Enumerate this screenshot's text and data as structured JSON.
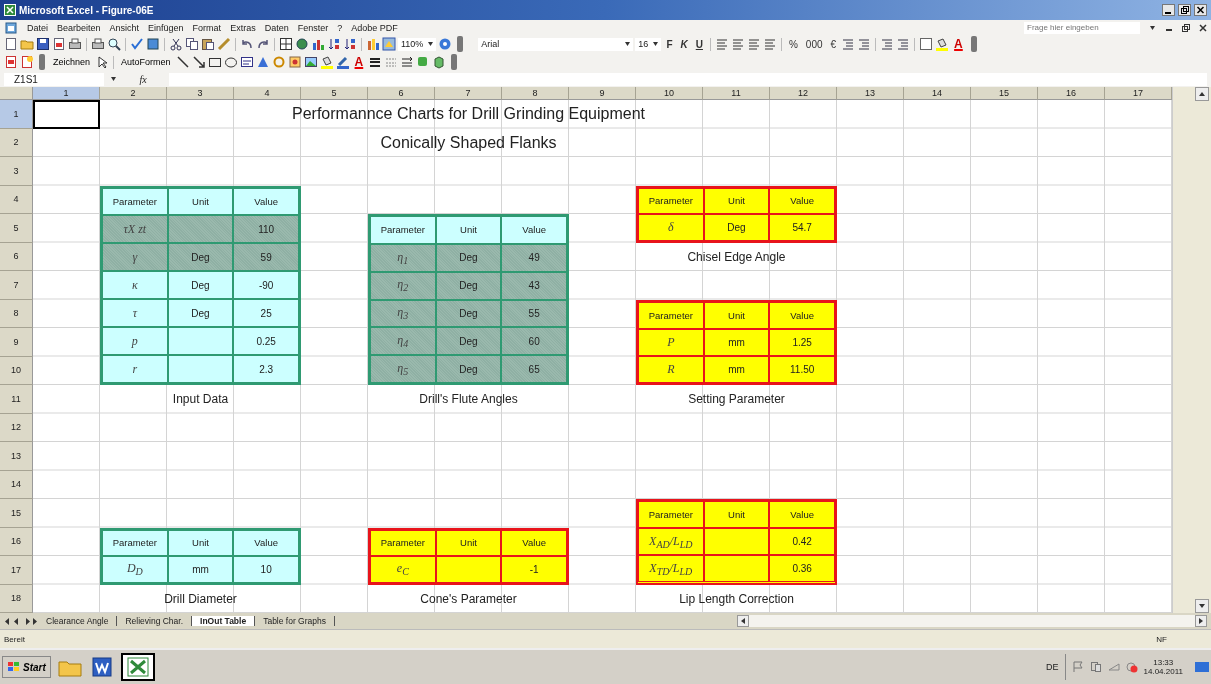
{
  "window": {
    "title": "Microsoft Excel - Figure-06E"
  },
  "menu": [
    "Datei",
    "Bearbeiten",
    "Ansicht",
    "Einfügen",
    "Format",
    "Extras",
    "Daten",
    "Fenster",
    "?",
    "Adobe PDF"
  ],
  "help_search": {
    "placeholder": "Frage hier eingeben"
  },
  "standard_toolbar": {
    "zoom": "110%"
  },
  "format_toolbar": {
    "font": "Arial",
    "size": "16",
    "style_buttons": [
      "F",
      "K",
      "U"
    ],
    "number_buttons": [
      "%",
      "000",
      "€"
    ],
    "font_color": "A"
  },
  "drawing_toolbar": {
    "menus": [
      "Zeichnen",
      "AutoFormen"
    ],
    "font_color": "A"
  },
  "formula_bar": {
    "name_box": "Z1S1",
    "function_label": "fx"
  },
  "column_headers": [
    {
      "label": "1",
      "selected": true
    },
    {
      "label": "2",
      "selected": false
    },
    {
      "label": "3",
      "selected": false
    },
    {
      "label": "4",
      "selected": false
    },
    {
      "label": "5",
      "selected": false
    },
    {
      "label": "6",
      "selected": false
    },
    {
      "label": "7",
      "selected": false
    },
    {
      "label": "8",
      "selected": false
    },
    {
      "label": "9",
      "selected": false
    },
    {
      "label": "10",
      "selected": false
    },
    {
      "label": "11",
      "selected": false
    },
    {
      "label": "12",
      "selected": false
    },
    {
      "label": "13",
      "selected": false
    },
    {
      "label": "14",
      "selected": false
    },
    {
      "label": "15",
      "selected": false
    },
    {
      "label": "16",
      "selected": false
    },
    {
      "label": "17",
      "selected": false
    }
  ],
  "row_headers": [
    {
      "label": "1",
      "selected": true
    },
    {
      "label": "2",
      "selected": false
    },
    {
      "label": "3",
      "selected": false
    },
    {
      "label": "4",
      "selected": false
    },
    {
      "label": "5",
      "selected": false
    },
    {
      "label": "6",
      "selected": false
    },
    {
      "label": "7",
      "selected": false
    },
    {
      "label": "8",
      "selected": false
    },
    {
      "label": "9",
      "selected": false
    },
    {
      "label": "10",
      "selected": false
    },
    {
      "label": "11",
      "selected": false
    },
    {
      "label": "12",
      "selected": false
    },
    {
      "label": "13",
      "selected": false
    },
    {
      "label": "14",
      "selected": false
    },
    {
      "label": "15",
      "selected": false
    },
    {
      "label": "16",
      "selected": false
    },
    {
      "label": "17",
      "selected": false
    },
    {
      "label": "18",
      "selected": false
    }
  ],
  "sheet": {
    "title": "Performannce Charts for Drill Grinding Equipment",
    "subtitle": "Conically Shaped Flanks",
    "tables": [
      {
        "caption": "Input Data",
        "color": "#ccffff",
        "columns": [
          "Parameter",
          "Unit",
          "Value"
        ],
        "rows": [
          {
            "symbol": "τX zt",
            "unit": "",
            "value": "110",
            "shaded": true
          },
          {
            "symbol": "γ",
            "unit": "Deg",
            "value": "59",
            "shaded": true
          },
          {
            "symbol": "κ",
            "unit": "Deg",
            "value": "-90",
            "shaded": false
          },
          {
            "symbol": "τ",
            "unit": "Deg",
            "value": "25",
            "shaded": false
          },
          {
            "symbol": "p",
            "unit": "",
            "value": "0.25",
            "shaded": false
          },
          {
            "symbol": "r",
            "unit": "",
            "value": "2.3",
            "shaded": false
          }
        ]
      },
      {
        "caption": "Drill's Flute  Angles",
        "color": "#ccffff",
        "columns": [
          "Parameter",
          "Unit",
          "Value"
        ],
        "rows": [
          {
            "symbol": "η$_{1}$",
            "unit": "Deg",
            "value": "49",
            "shaded": true
          },
          {
            "symbol": "η$_{2}$",
            "unit": "Deg",
            "value": "43",
            "shaded": true
          },
          {
            "symbol": "η$_{3}$",
            "unit": "Deg",
            "value": "55",
            "shaded": true
          },
          {
            "symbol": "η$_{4}$",
            "unit": "Deg",
            "value": "60",
            "shaded": true
          },
          {
            "symbol": "η$_{5}$",
            "unit": "Deg",
            "value": "65",
            "shaded": true
          }
        ]
      },
      {
        "caption": "Chisel Edge Angle",
        "color": "#ffff00",
        "columns": [
          "Parameter",
          "Unit",
          "Value"
        ],
        "rows": [
          {
            "symbol": "δ",
            "unit": "Deg",
            "value": "54.7",
            "shaded": false
          }
        ]
      },
      {
        "caption": "Setting Parameter",
        "color": "#ffff00",
        "columns": [
          "Parameter",
          "Unit",
          "Value"
        ],
        "rows": [
          {
            "symbol": "P",
            "unit": "mm",
            "value": "1.25",
            "shaded": false
          },
          {
            "symbol": "R",
            "unit": "mm",
            "value": "11.50",
            "shaded": false
          }
        ]
      },
      {
        "caption": "Drill Diameter",
        "color": "#ccffff",
        "columns": [
          "Parameter",
          "Unit",
          "Value"
        ],
        "rows": [
          {
            "symbol": "D$_{D}$",
            "unit": "mm",
            "value": "10",
            "shaded": false
          }
        ]
      },
      {
        "caption": "Cone's Parameter",
        "color": "#ffff00",
        "columns": [
          "Parameter",
          "Unit",
          "Value"
        ],
        "rows": [
          {
            "symbol": "e$_{C}$",
            "unit": "",
            "value": "-1",
            "shaded": false
          }
        ]
      },
      {
        "caption": "Lip Length Correction",
        "color": "#ffff00",
        "columns": [
          "Parameter",
          "Unit",
          "Value"
        ],
        "rows": [
          {
            "symbol": "X$_{AD}$/L$_{LD}$",
            "unit": "",
            "value": "0.42",
            "shaded": false
          },
          {
            "symbol": "X$_{TD}$/L$_{LD}$",
            "unit": "",
            "value": "0.36",
            "shaded": false
          }
        ]
      }
    ]
  },
  "sheet_tabs": [
    {
      "label": "Clearance Angle",
      "selected": false
    },
    {
      "label": "Relieving Char.",
      "selected": false
    },
    {
      "label": "InOut Table",
      "selected": true
    },
    {
      "label": "Table for Graphs",
      "selected": false
    }
  ],
  "status_bar": {
    "status": "Bereit",
    "indicator": "NF"
  },
  "taskbar": {
    "start": "Start",
    "language": "DE",
    "time": "13:33",
    "date": "14.04.2011"
  }
}
